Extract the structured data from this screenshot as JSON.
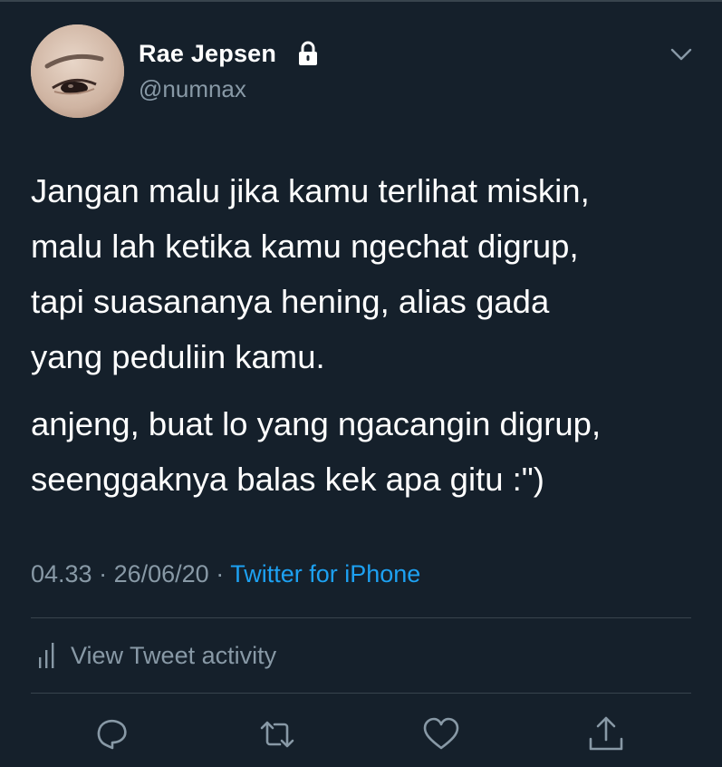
{
  "author": {
    "name": "Rae Jepsen",
    "handle": "@numnax",
    "protected_icon": "lock-icon",
    "menu_icon": "chevron-down-icon"
  },
  "tweet": {
    "paragraphs": [
      "Jangan malu jika kamu terlihat miskin,\nmalu lah ketika kamu ngechat digrup,\ntapi suasananya hening, alias gada\nyang peduliin kamu.",
      "anjeng, buat lo yang ngacangin digrup,\nseenggaknya balas kek apa gitu :\")"
    ],
    "time": "04.33",
    "date": "26/06/20",
    "separator": " · ",
    "source": "Twitter for iPhone"
  },
  "activity": {
    "label": "View Tweet activity",
    "icon": "bar-chart-icon"
  },
  "actions": [
    {
      "icon": "reply-icon"
    },
    {
      "icon": "retweet-icon"
    },
    {
      "icon": "like-icon"
    },
    {
      "icon": "share-icon"
    }
  ],
  "colors": {
    "background": "#15202b",
    "text": "#ffffff",
    "secondary_text": "#8899a6",
    "link": "#1da1f2",
    "divider": "#38444d"
  }
}
